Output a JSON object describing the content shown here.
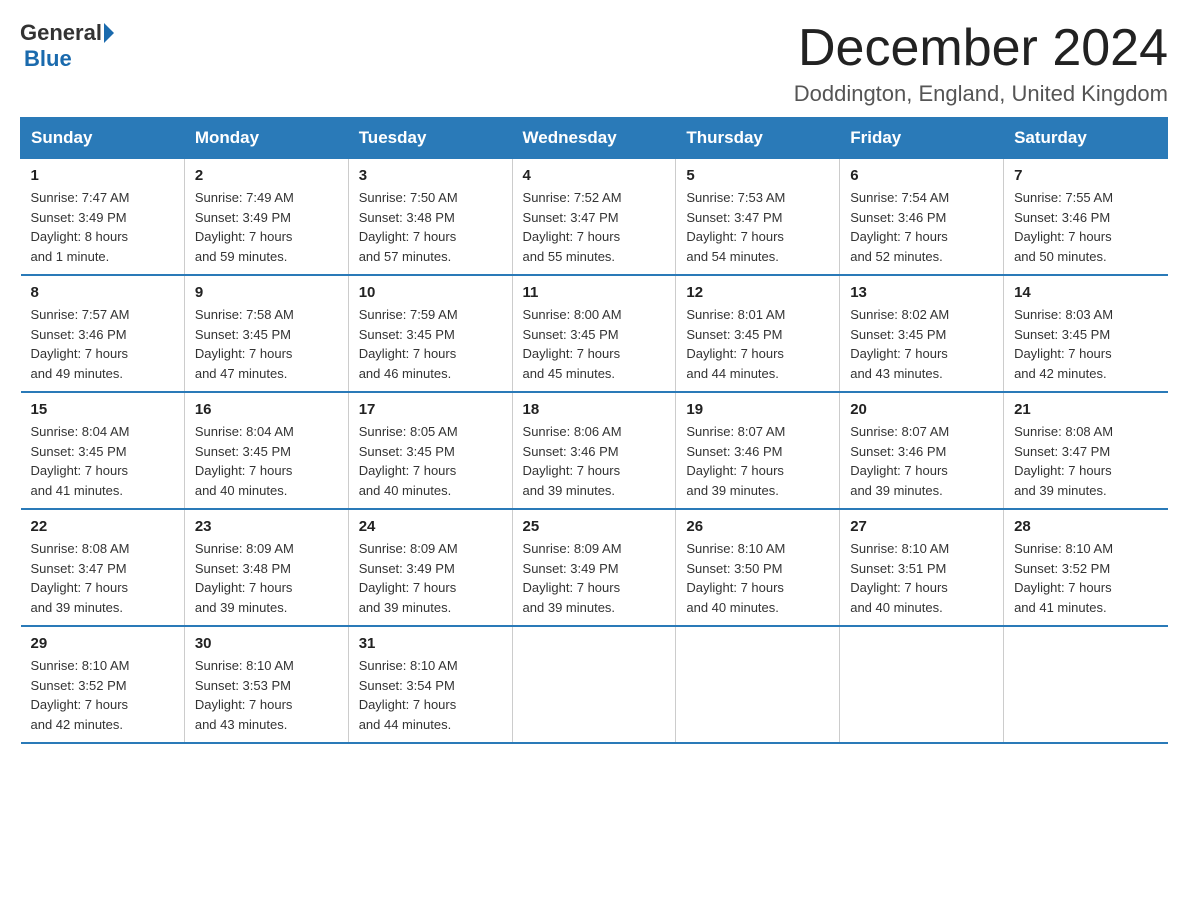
{
  "logo": {
    "general": "General",
    "blue": "Blue"
  },
  "title": "December 2024",
  "subtitle": "Doddington, England, United Kingdom",
  "days_header": [
    "Sunday",
    "Monday",
    "Tuesday",
    "Wednesday",
    "Thursday",
    "Friday",
    "Saturday"
  ],
  "weeks": [
    [
      {
        "day": "1",
        "info": "Sunrise: 7:47 AM\nSunset: 3:49 PM\nDaylight: 8 hours\nand 1 minute."
      },
      {
        "day": "2",
        "info": "Sunrise: 7:49 AM\nSunset: 3:49 PM\nDaylight: 7 hours\nand 59 minutes."
      },
      {
        "day": "3",
        "info": "Sunrise: 7:50 AM\nSunset: 3:48 PM\nDaylight: 7 hours\nand 57 minutes."
      },
      {
        "day": "4",
        "info": "Sunrise: 7:52 AM\nSunset: 3:47 PM\nDaylight: 7 hours\nand 55 minutes."
      },
      {
        "day": "5",
        "info": "Sunrise: 7:53 AM\nSunset: 3:47 PM\nDaylight: 7 hours\nand 54 minutes."
      },
      {
        "day": "6",
        "info": "Sunrise: 7:54 AM\nSunset: 3:46 PM\nDaylight: 7 hours\nand 52 minutes."
      },
      {
        "day": "7",
        "info": "Sunrise: 7:55 AM\nSunset: 3:46 PM\nDaylight: 7 hours\nand 50 minutes."
      }
    ],
    [
      {
        "day": "8",
        "info": "Sunrise: 7:57 AM\nSunset: 3:46 PM\nDaylight: 7 hours\nand 49 minutes."
      },
      {
        "day": "9",
        "info": "Sunrise: 7:58 AM\nSunset: 3:45 PM\nDaylight: 7 hours\nand 47 minutes."
      },
      {
        "day": "10",
        "info": "Sunrise: 7:59 AM\nSunset: 3:45 PM\nDaylight: 7 hours\nand 46 minutes."
      },
      {
        "day": "11",
        "info": "Sunrise: 8:00 AM\nSunset: 3:45 PM\nDaylight: 7 hours\nand 45 minutes."
      },
      {
        "day": "12",
        "info": "Sunrise: 8:01 AM\nSunset: 3:45 PM\nDaylight: 7 hours\nand 44 minutes."
      },
      {
        "day": "13",
        "info": "Sunrise: 8:02 AM\nSunset: 3:45 PM\nDaylight: 7 hours\nand 43 minutes."
      },
      {
        "day": "14",
        "info": "Sunrise: 8:03 AM\nSunset: 3:45 PM\nDaylight: 7 hours\nand 42 minutes."
      }
    ],
    [
      {
        "day": "15",
        "info": "Sunrise: 8:04 AM\nSunset: 3:45 PM\nDaylight: 7 hours\nand 41 minutes."
      },
      {
        "day": "16",
        "info": "Sunrise: 8:04 AM\nSunset: 3:45 PM\nDaylight: 7 hours\nand 40 minutes."
      },
      {
        "day": "17",
        "info": "Sunrise: 8:05 AM\nSunset: 3:45 PM\nDaylight: 7 hours\nand 40 minutes."
      },
      {
        "day": "18",
        "info": "Sunrise: 8:06 AM\nSunset: 3:46 PM\nDaylight: 7 hours\nand 39 minutes."
      },
      {
        "day": "19",
        "info": "Sunrise: 8:07 AM\nSunset: 3:46 PM\nDaylight: 7 hours\nand 39 minutes."
      },
      {
        "day": "20",
        "info": "Sunrise: 8:07 AM\nSunset: 3:46 PM\nDaylight: 7 hours\nand 39 minutes."
      },
      {
        "day": "21",
        "info": "Sunrise: 8:08 AM\nSunset: 3:47 PM\nDaylight: 7 hours\nand 39 minutes."
      }
    ],
    [
      {
        "day": "22",
        "info": "Sunrise: 8:08 AM\nSunset: 3:47 PM\nDaylight: 7 hours\nand 39 minutes."
      },
      {
        "day": "23",
        "info": "Sunrise: 8:09 AM\nSunset: 3:48 PM\nDaylight: 7 hours\nand 39 minutes."
      },
      {
        "day": "24",
        "info": "Sunrise: 8:09 AM\nSunset: 3:49 PM\nDaylight: 7 hours\nand 39 minutes."
      },
      {
        "day": "25",
        "info": "Sunrise: 8:09 AM\nSunset: 3:49 PM\nDaylight: 7 hours\nand 39 minutes."
      },
      {
        "day": "26",
        "info": "Sunrise: 8:10 AM\nSunset: 3:50 PM\nDaylight: 7 hours\nand 40 minutes."
      },
      {
        "day": "27",
        "info": "Sunrise: 8:10 AM\nSunset: 3:51 PM\nDaylight: 7 hours\nand 40 minutes."
      },
      {
        "day": "28",
        "info": "Sunrise: 8:10 AM\nSunset: 3:52 PM\nDaylight: 7 hours\nand 41 minutes."
      }
    ],
    [
      {
        "day": "29",
        "info": "Sunrise: 8:10 AM\nSunset: 3:52 PM\nDaylight: 7 hours\nand 42 minutes."
      },
      {
        "day": "30",
        "info": "Sunrise: 8:10 AM\nSunset: 3:53 PM\nDaylight: 7 hours\nand 43 minutes."
      },
      {
        "day": "31",
        "info": "Sunrise: 8:10 AM\nSunset: 3:54 PM\nDaylight: 7 hours\nand 44 minutes."
      },
      {
        "day": "",
        "info": ""
      },
      {
        "day": "",
        "info": ""
      },
      {
        "day": "",
        "info": ""
      },
      {
        "day": "",
        "info": ""
      }
    ]
  ]
}
